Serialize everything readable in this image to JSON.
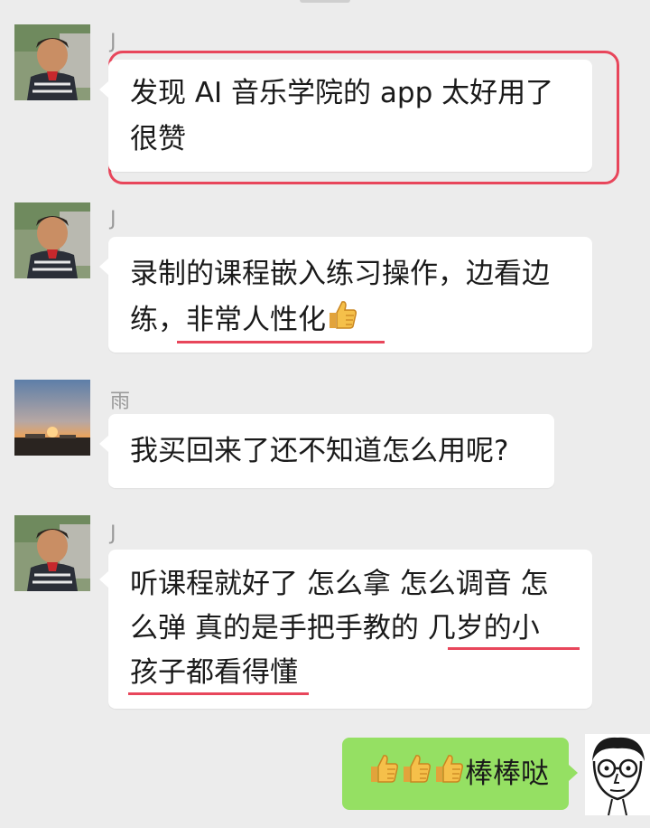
{
  "messages": [
    {
      "sender": "J",
      "line1": "发现 AI 音乐学院的 app 太好用了",
      "line2": "很赞"
    },
    {
      "sender": "J",
      "line1": "录制的课程嵌入练习操作，边看边",
      "line2_a": "练，",
      "line2_b": "非常人性化"
    },
    {
      "sender": "雨",
      "line1": "我买回来了还不知道怎么用呢?"
    },
    {
      "sender": "J",
      "line1": "听课程就好了 怎么拿 怎么调音 怎",
      "line2_a": "么弹 真的是手把手教的 ",
      "line2_b": "几岁的小",
      "line3": "孩子都看得懂"
    }
  ],
  "self_message": {
    "text": "棒棒哒"
  },
  "colors": {
    "highlight": "#e8465b",
    "self_bubble": "#95e063",
    "background": "#ececec"
  },
  "icons": [
    "thumbs-up-icon",
    "boy-avatar",
    "sunset-avatar",
    "glasses-avatar"
  ]
}
